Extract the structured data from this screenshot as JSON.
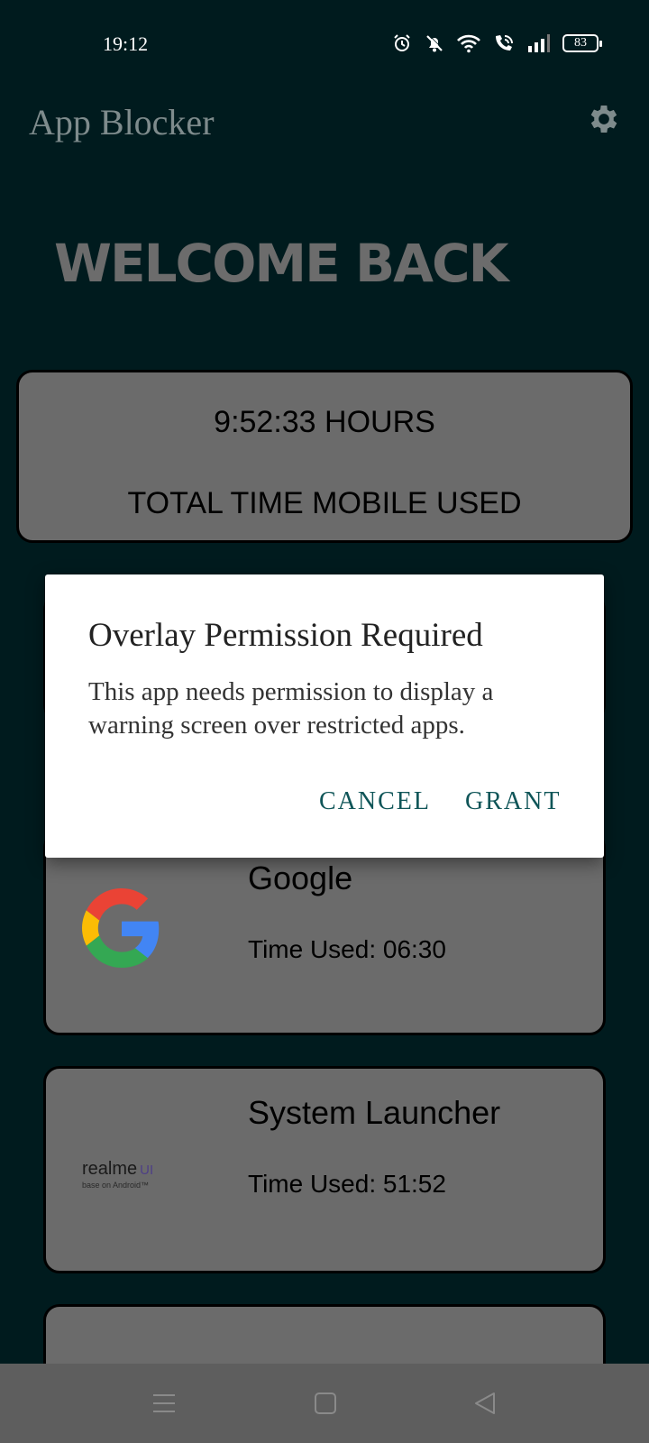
{
  "status_bar": {
    "time": "19:12",
    "battery": "83",
    "icons": [
      "alarm-icon",
      "silent-bell-icon",
      "wifi-icon",
      "wifi-call-icon",
      "signal-icon",
      "battery-icon"
    ]
  },
  "app_bar": {
    "title": "App Blocker",
    "settings_icon": "gear-icon"
  },
  "main": {
    "welcome": "WELCOME BACK",
    "summary": {
      "hours": "9:52:33 HOURS",
      "label": "TOTAL TIME MOBILE USED"
    },
    "apps": [
      {
        "name": "Google",
        "time": "Time Used: 06:30",
        "icon": "google-logo-icon"
      },
      {
        "name": "System Launcher",
        "time": "Time Used: 51:52",
        "icon": "realme-ui-logo",
        "logo_text": "realme",
        "logo_badge": "UI",
        "logo_sub": "base on Android™"
      }
    ]
  },
  "dialog": {
    "title": "Overlay Permission Required",
    "message": "This app needs permission to display a warning screen over restricted apps.",
    "cancel": "CANCEL",
    "grant": "GRANT"
  },
  "nav_bar": {
    "icons": [
      "menu-icon",
      "home-icon",
      "back-icon"
    ]
  },
  "colors": {
    "background": "#001b1e",
    "card": "#6b6b6b",
    "dialog_button": "#0f5558"
  }
}
